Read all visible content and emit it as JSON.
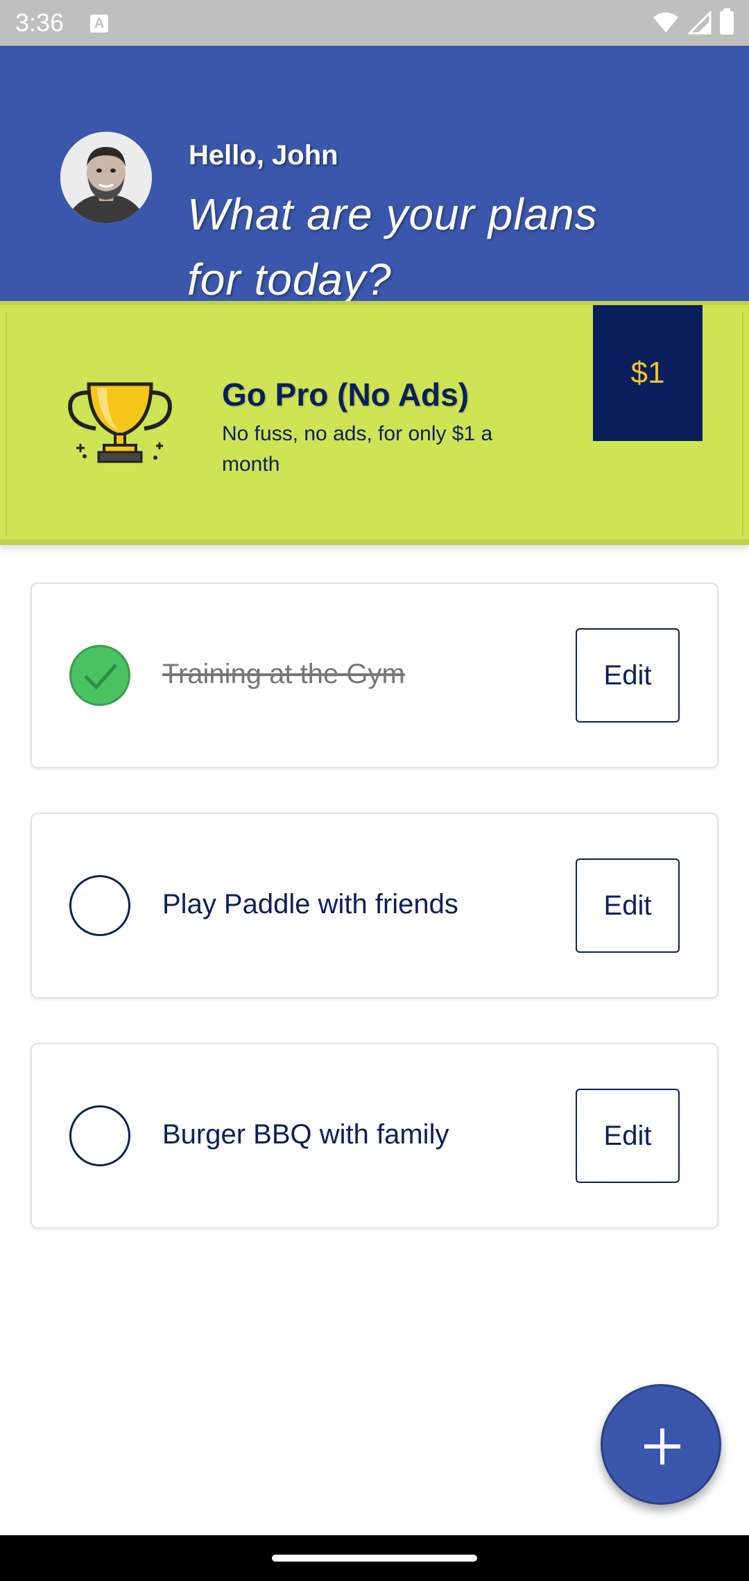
{
  "status_bar": {
    "time": "3:36",
    "notification_icon": "a-icon",
    "icons": [
      "wifi-icon",
      "signal-icon",
      "battery-icon"
    ]
  },
  "header": {
    "greeting": "Hello, John",
    "headline": "What are your plans for today?",
    "avatar_icon": "user-avatar"
  },
  "promo": {
    "icon": "trophy-icon",
    "title": "Go Pro (No Ads)",
    "description": "No fuss, no ads, for only $1 a month",
    "price": "$1"
  },
  "tasks": [
    {
      "label": "Training at the Gym",
      "completed": true,
      "edit_label": "Edit"
    },
    {
      "label": "Play Paddle with friends",
      "completed": false,
      "edit_label": "Edit"
    },
    {
      "label": "Burger BBQ with family",
      "completed": false,
      "edit_label": "Edit"
    }
  ],
  "fab": {
    "icon": "plus-icon"
  },
  "colors": {
    "header": "#3b57ac",
    "promo": "#cfe454",
    "navy": "#0b1f5c",
    "gold": "#f2c230",
    "done_green": "#4ac262"
  }
}
